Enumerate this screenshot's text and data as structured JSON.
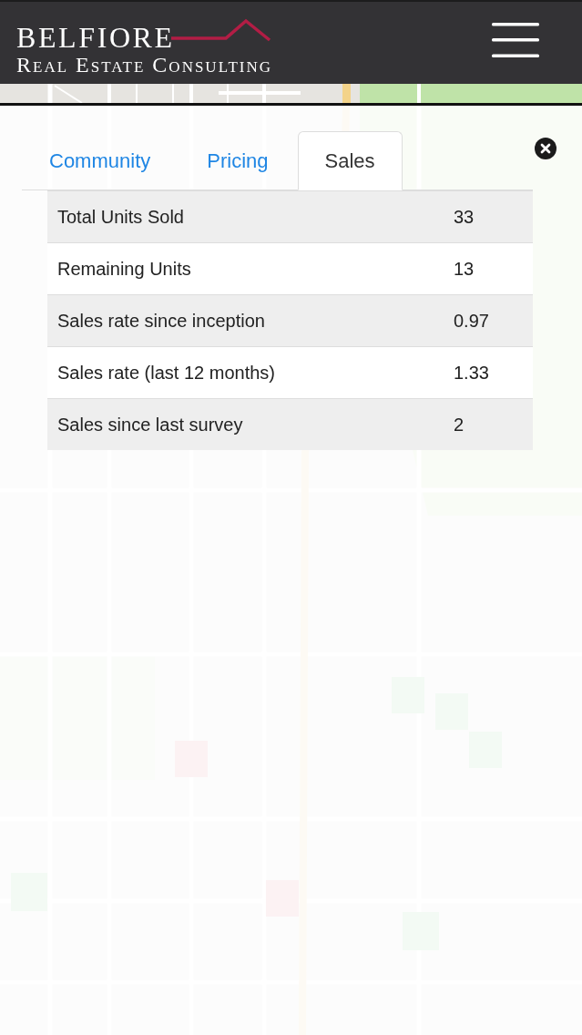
{
  "header": {
    "logo_title": "BELFIORE",
    "logo_subtitle": "Real Estate Consulting"
  },
  "tabs": [
    {
      "label": "Community",
      "selected": false
    },
    {
      "label": "Pricing",
      "selected": false
    },
    {
      "label": "Sales",
      "selected": true
    }
  ],
  "table": {
    "rows": [
      {
        "label": "Total Units Sold",
        "value": "33"
      },
      {
        "label": "Remaining Units",
        "value": "13"
      },
      {
        "label": "Sales rate since inception",
        "value": "0.97"
      },
      {
        "label": "Sales rate (last 12 months)",
        "value": "1.33"
      },
      {
        "label": "Sales since last survey",
        "value": "2"
      }
    ]
  }
}
